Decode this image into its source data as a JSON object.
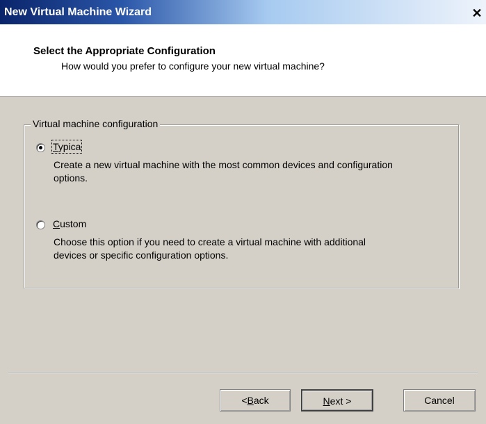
{
  "window": {
    "title": "New Virtual Machine Wizard",
    "close_glyph": "✕"
  },
  "header": {
    "title": "Select the Appropriate Configuration",
    "subtitle": "How would you prefer to configure your new virtual machine?"
  },
  "config": {
    "group_label": "Virtual machine configuration",
    "selected": "typical",
    "options": [
      {
        "id": "typical",
        "accel": "T",
        "label_rest": "ypica",
        "description_line1": "Create a new virtual machine with the most common devices and configuration",
        "description_line2": "options."
      },
      {
        "id": "custom",
        "accel": "C",
        "label_rest": "ustom",
        "description_line1": "Choose this option if you need to create a virtual machine with additional",
        "description_line2": "devices or specific configuration options."
      }
    ]
  },
  "buttons": {
    "back_prefix": "<",
    "back_accel": "B",
    "back_rest": "ack",
    "next_accel": "N",
    "next_rest": "ext",
    "next_suffix": " >",
    "cancel": "Cancel"
  }
}
